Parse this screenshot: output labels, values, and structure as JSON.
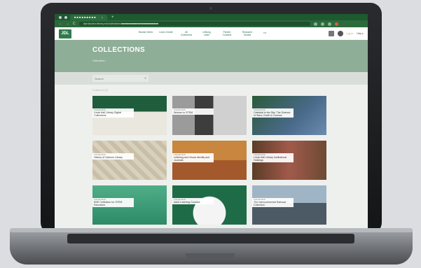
{
  "browser": {
    "tab_title": "■ ■ ■ ■ ■ ■ ■ ■ ■",
    "tab_close": "×",
    "new_tab": "+",
    "url": "nlproduction.library.edu/collections/■■■■■■■■■■■■■■■■■■■■■■■■■",
    "back": "←",
    "forward": "→",
    "reload": "C"
  },
  "header": {
    "logo_text": "JDL",
    "nav": [
      {
        "label": "Browse Items"
      },
      {
        "label": "Learn Create"
      },
      {
        "label": "All Collections"
      },
      {
        "label": "Lifelong Learn"
      },
      {
        "label": "Partner Curators"
      },
      {
        "label": "Research Guides"
      }
    ],
    "more": "•••",
    "login": "Log in",
    "help": "Help ▸"
  },
  "banner": {
    "title": "COLLECTIONS",
    "breadcrumb": "Collections ›"
  },
  "search": {
    "placeholder": "Search",
    "icon": "search-icon"
  },
  "content": {
    "section_label": "Featured (9)",
    "cards": [
      {
        "kind": "COLLECTION",
        "title": "Linda Hall Library Digital Collections"
      },
      {
        "kind": "COLLECTION",
        "title": "Women in STEM"
      },
      {
        "kind": "COLLECTION",
        "title": "Celestial in the Sky: The Science of Stars, Earth & Cosmos"
      },
      {
        "kind": "COLLECTION",
        "title": "History of Science Library"
      },
      {
        "kind": "COLLECTION",
        "title": "Lettering and Visual Identity and Journals"
      },
      {
        "kind": "COLLECTION",
        "title": "Linda Hall Library Institutional Holdings"
      },
      {
        "kind": "COLLECTION",
        "title": "ENE Collection for STEM Educators"
      },
      {
        "kind": "COLLECTION",
        "title": "Adult Learning Courses"
      },
      {
        "kind": "COLLECTION",
        "title": "The Intercontinental Railroad Collection"
      }
    ]
  }
}
